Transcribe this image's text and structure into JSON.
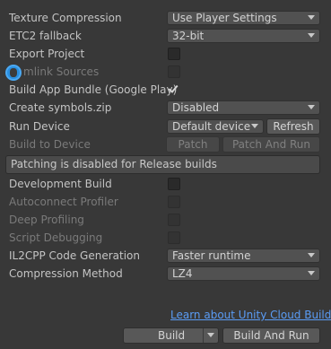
{
  "rows": {
    "texture_compression": {
      "label": "Texture Compression",
      "value": "Use Player Settings"
    },
    "etc2_fallback": {
      "label": "ETC2 fallback",
      "value": "32-bit"
    },
    "export_project": {
      "label": "Export Project"
    },
    "symlink_sources": {
      "label": "mlink Sources"
    },
    "build_app_bundle": {
      "label": "Build App Bundle (Google Play)"
    },
    "create_symbols": {
      "label": "Create symbols.zip",
      "value": "Disabled"
    },
    "run_device": {
      "label": "Run Device",
      "value": "Default device",
      "refresh": "Refresh"
    },
    "build_to_device": {
      "label": "Build to Device",
      "patch": "Patch",
      "patch_and_run": "Patch And Run"
    },
    "info": "Patching is disabled for Release builds",
    "development_build": {
      "label": "Development Build"
    },
    "autoconnect_profiler": {
      "label": "Autoconnect Profiler"
    },
    "deep_profiling": {
      "label": "Deep Profiling"
    },
    "script_debugging": {
      "label": "Script Debugging"
    },
    "il2cpp_code_generation": {
      "label": "IL2CPP Code Generation",
      "value": "Faster runtime"
    },
    "compression_method": {
      "label": "Compression Method",
      "value": "LZ4"
    }
  },
  "footer": {
    "cloud_build_link": "Learn about Unity Cloud Build",
    "build": "Build",
    "build_and_run": "Build And Run"
  },
  "colors": {
    "background": "#383838",
    "link": "#5a9cf5",
    "overlay_icon": "#2a8fe0"
  }
}
